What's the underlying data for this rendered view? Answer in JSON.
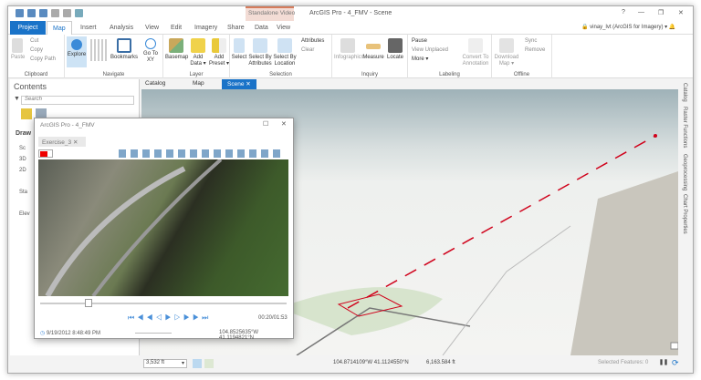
{
  "title": "ArcGIS Pro - 4_FMV - Scene",
  "window_controls": {
    "help": "?",
    "minimize": "—",
    "restore": "❐",
    "close": "✕"
  },
  "contextual_tab": "Standalone Video",
  "tabs": [
    "Project",
    "Map",
    "Insert",
    "Analysis",
    "View",
    "Edit",
    "Imagery",
    "Share",
    "Data",
    "View"
  ],
  "user": "vinay_lvt (ArcGIS for Imagery) ▾",
  "ribbon": {
    "clipboard": {
      "label": "Clipboard",
      "paste": "Paste",
      "cut": "Cut",
      "copy": "Copy",
      "copy_path": "Copy Path"
    },
    "navigate": {
      "label": "Navigate",
      "explore": "Explore",
      "bookmarks": "Bookmarks",
      "goto": "Go To XY"
    },
    "layer": {
      "label": "Layer",
      "basemap": "Basemap",
      "add_data": "Add Data ▾",
      "add_preset": "Add Preset ▾"
    },
    "selection": {
      "label": "Selection",
      "select": "Select",
      "by_attr": "Select By Attributes",
      "by_loc": "Select By Location",
      "attributes": "Attributes",
      "clear": "Clear"
    },
    "inquiry": {
      "label": "Inquiry",
      "infographics": "Infographics",
      "measure": "Measure",
      "locate": "Locate"
    },
    "labeling": {
      "label": "Labeling",
      "pause": "Pause",
      "view_unplaced": "View Unplaced",
      "more": "More ▾",
      "convert": "Convert To Annotation"
    },
    "offline": {
      "label": "Offline",
      "download": "Download Map ▾",
      "sync": "Sync",
      "remove": "Remove"
    }
  },
  "contents": {
    "title": "Contents",
    "search_placeholder": "Search",
    "drawing_order": "Draw",
    "items": [
      "Sc",
      "3D",
      "2D",
      "Sta",
      "Elev"
    ]
  },
  "view_tabs": [
    "Catalog",
    "Map",
    "Scene"
  ],
  "side_tabs": [
    "Catalog",
    "Raster Functions",
    "Geoprocessing",
    "Chart Properties"
  ],
  "fmv": {
    "title": "ArcGIS Pro - 4_FMV",
    "tab": "Exercise_3",
    "time": "00:20/01:53",
    "datetime": "9/19/2012 8:48:49 PM",
    "coords": "104.8525635°W 41.1194821°N",
    "progress": 0.18
  },
  "status": {
    "scale": "3,532 ft",
    "coords": "104.8714109°W 41.1124550°N",
    "elevation": "6,163.584 ft",
    "selected": "Selected Features: 0"
  },
  "colors": {
    "accent": "#1a73c8",
    "track": "#d0021b"
  }
}
